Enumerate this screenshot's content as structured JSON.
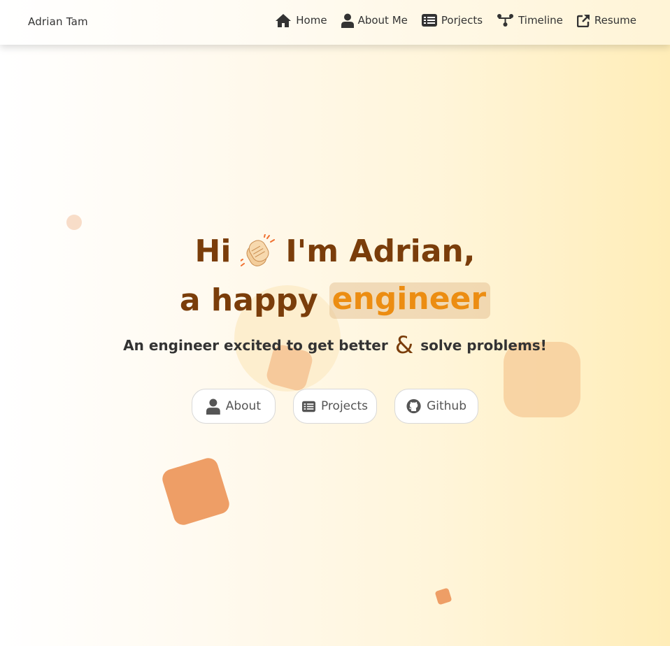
{
  "nav": {
    "brand": "Adrian Tam",
    "links": [
      {
        "label": "Home",
        "icon": "home-icon"
      },
      {
        "label": "About Me",
        "icon": "user-icon"
      },
      {
        "label": "Porjects",
        "icon": "list-icon"
      },
      {
        "label": "Timeline",
        "icon": "sitemap-icon"
      },
      {
        "label": "Resume",
        "icon": "external-link-icon"
      }
    ]
  },
  "hero": {
    "greeting": "Hi",
    "wave_emoji": "👏",
    "intro": "I'm Adrian,",
    "role_prefix": "a happy",
    "role": "engineer",
    "subtitle_part1": "An engineer excited to get better",
    "ampersand": "&",
    "subtitle_part2": "solve problems!"
  },
  "buttons": [
    {
      "label": "About",
      "icon": "user-icon"
    },
    {
      "label": "Projects",
      "icon": "list-icon"
    },
    {
      "label": "Github",
      "icon": "github-icon"
    }
  ],
  "colors": {
    "heading": "#7a3d0a",
    "accent": "#ec8d12",
    "shape_orange": "#ee9e66",
    "shape_peach": "#f7cf9c"
  }
}
